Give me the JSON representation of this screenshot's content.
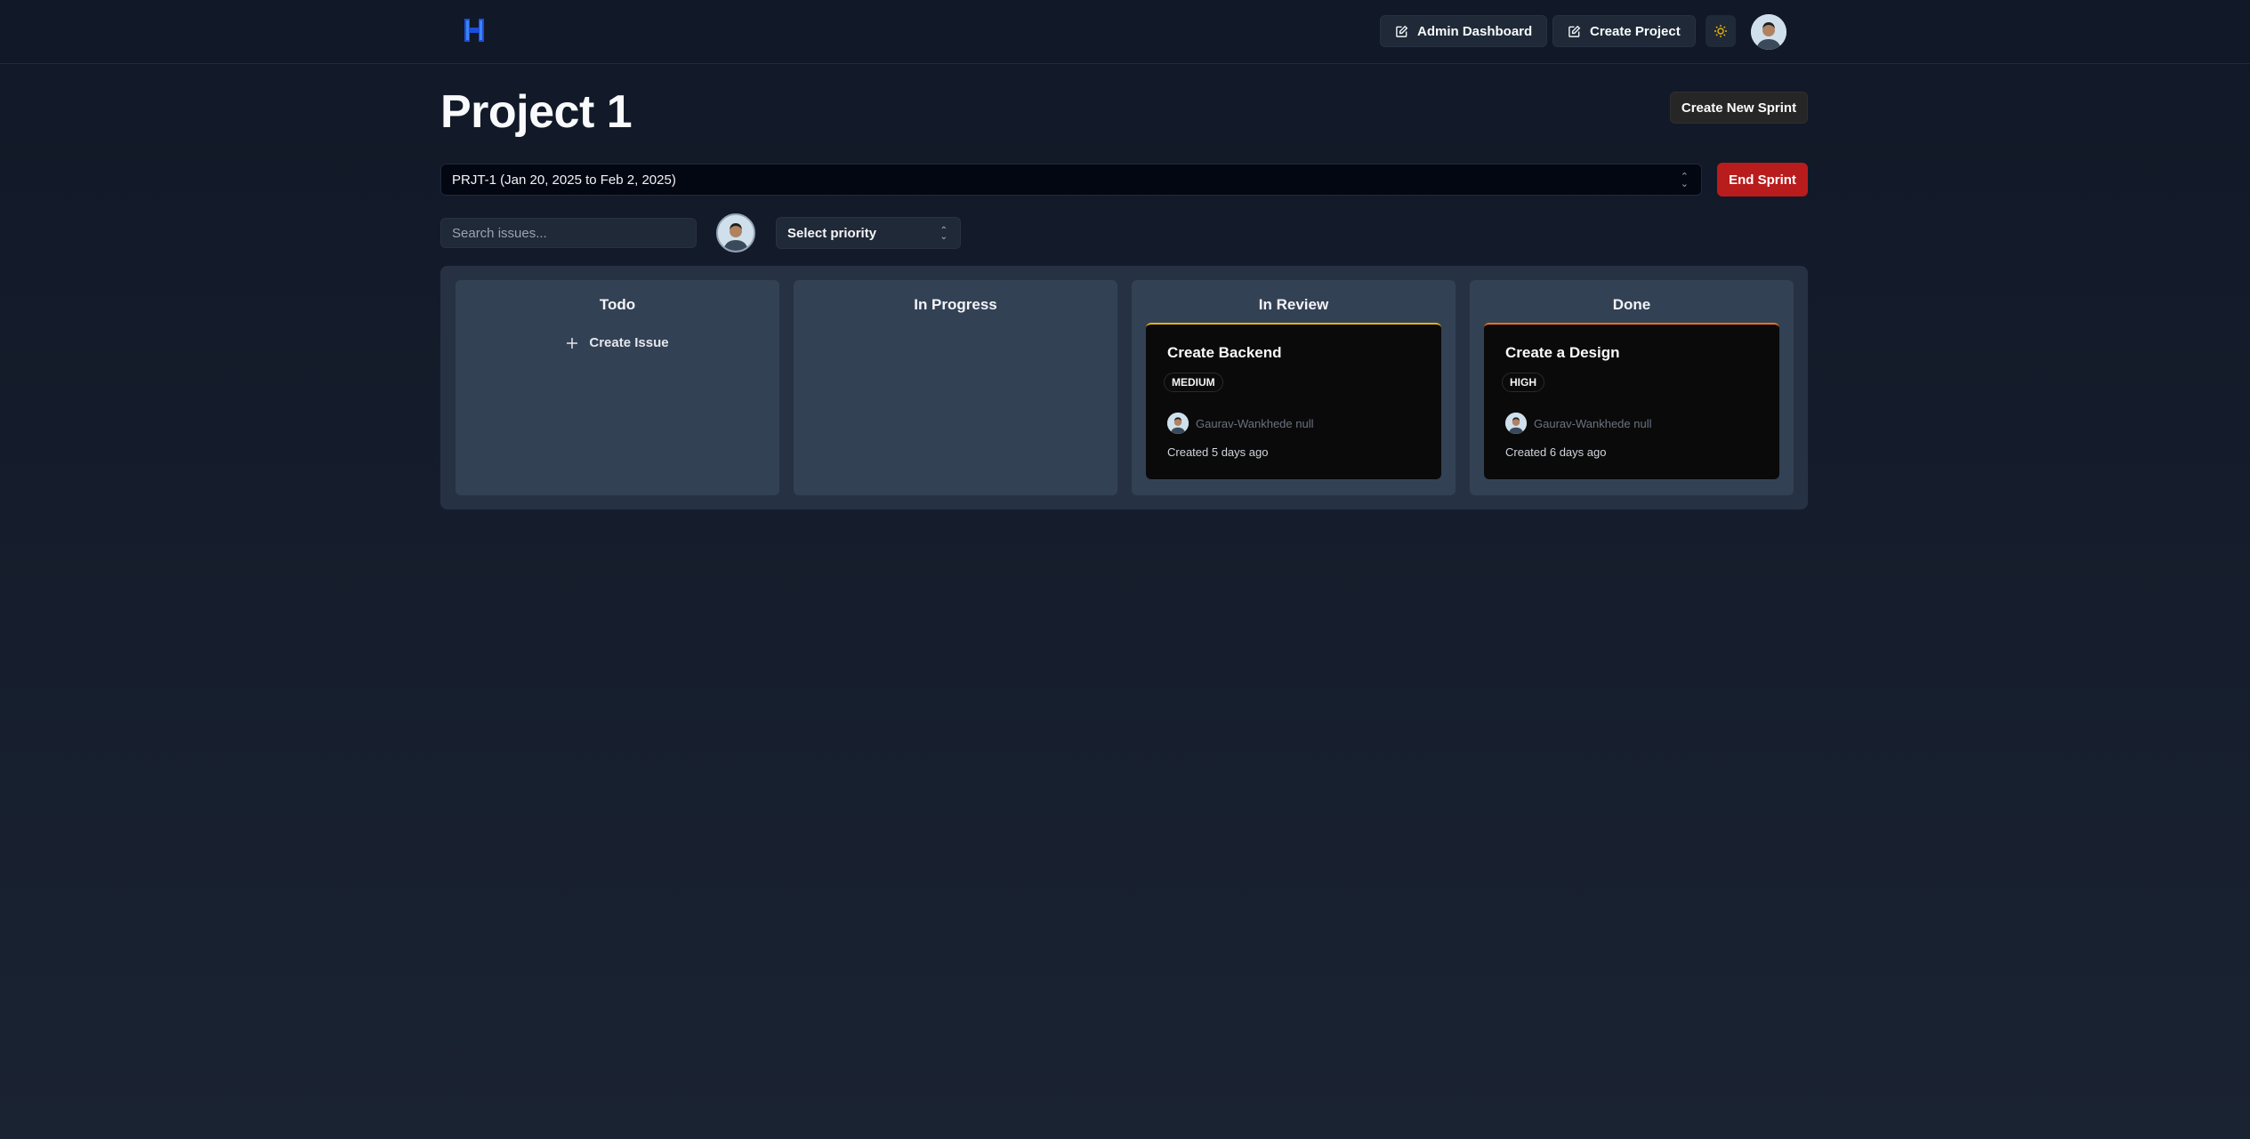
{
  "header": {
    "admin_dashboard_label": "Admin Dashboard",
    "create_project_label": "Create Project"
  },
  "page": {
    "title": "Project 1",
    "create_sprint_label": "Create New Sprint",
    "end_sprint_label": "End Sprint"
  },
  "sprint": {
    "selected": "PRJT-1 (Jan 20, 2025 to Feb 2, 2025)"
  },
  "filters": {
    "search_placeholder": "Search issues...",
    "priority_placeholder": "Select priority"
  },
  "board": {
    "columns": [
      {
        "title": "Todo",
        "create_issue_label": "Create Issue"
      },
      {
        "title": "In Progress"
      },
      {
        "title": "In Review",
        "card": {
          "title": "Create Backend",
          "priority": "MEDIUM",
          "assignee": "Gaurav-Wankhede null",
          "created": "Created 5 days ago",
          "accent": "#eab308"
        }
      },
      {
        "title": "Done",
        "card": {
          "title": "Create a Design",
          "priority": "HIGH",
          "assignee": "Gaurav-Wankhede null",
          "created": "Created 6 days ago",
          "accent": "#f97316"
        }
      }
    ]
  },
  "colors": {
    "end_sprint": "#b91c1c",
    "logo": "#3b82f6",
    "theme_icon": "#eab308"
  }
}
